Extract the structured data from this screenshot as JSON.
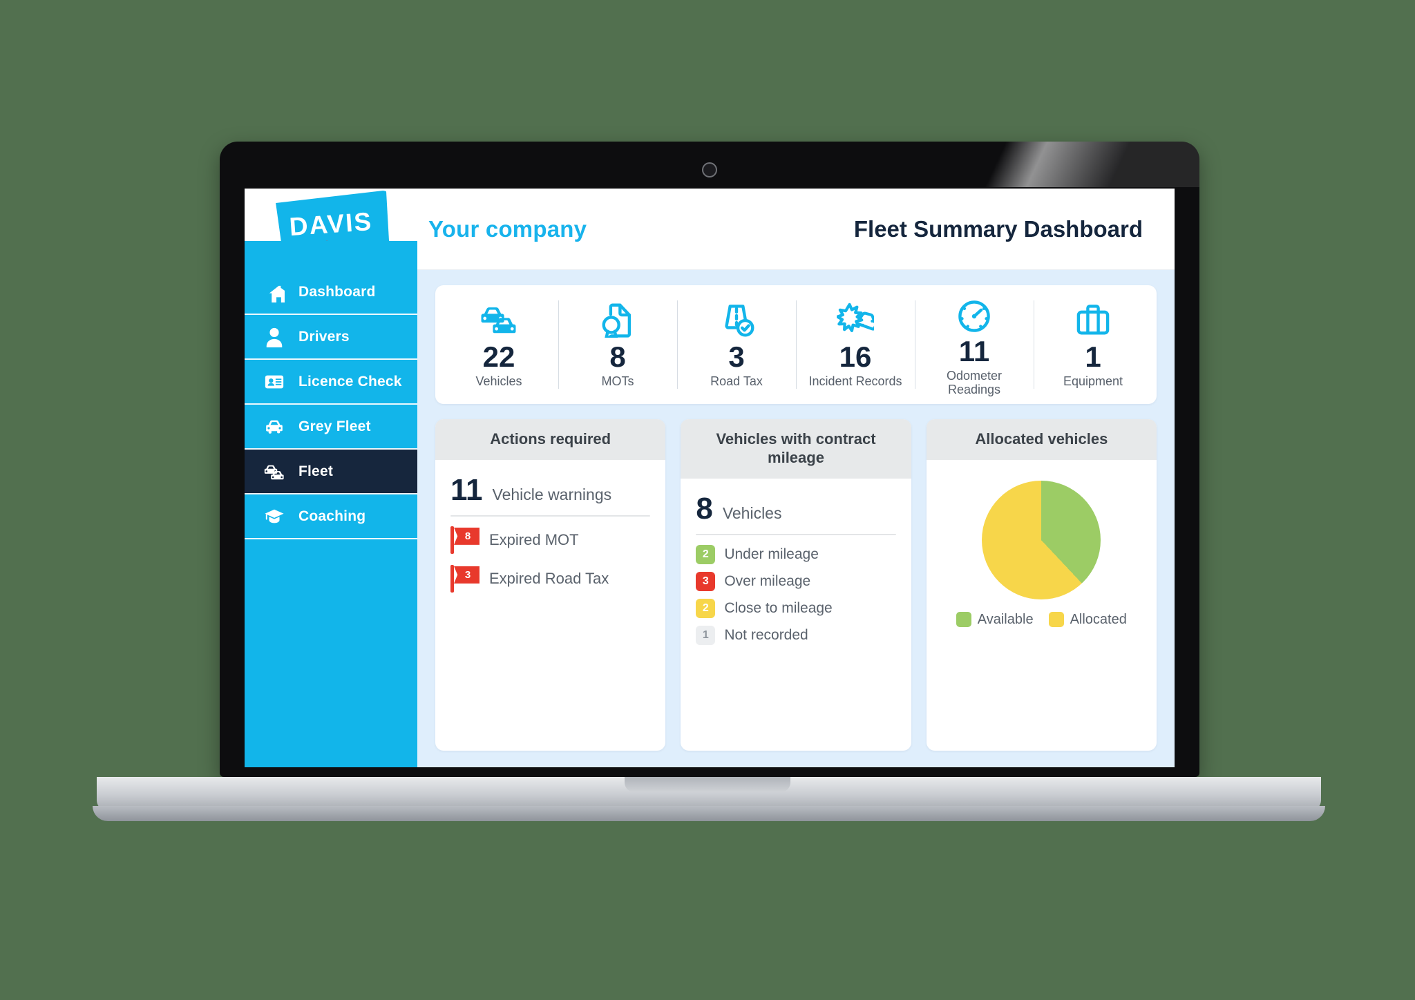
{
  "brand": {
    "logo_text": "DAVIS",
    "logo_dots": [
      "#8cc152",
      "#f7d64a",
      "#e8392c"
    ],
    "primary": "#12b5ea",
    "dark": "#16263d"
  },
  "header": {
    "company": "Your company",
    "page_title": "Fleet Summary Dashboard"
  },
  "sidebar": {
    "items": [
      {
        "label": "Dashboard",
        "icon": "home-icon",
        "active": false
      },
      {
        "label": "Drivers",
        "icon": "user-icon",
        "active": false
      },
      {
        "label": "Licence Check",
        "icon": "id-card-icon",
        "active": false
      },
      {
        "label": "Grey Fleet",
        "icon": "car-icon",
        "active": false
      },
      {
        "label": "Fleet",
        "icon": "two-cars-icon",
        "active": true
      },
      {
        "label": "Coaching",
        "icon": "graduation-cap-icon",
        "active": false
      }
    ]
  },
  "kpis": [
    {
      "value": "22",
      "label": "Vehicles",
      "icon": "two-cars-icon"
    },
    {
      "value": "8",
      "label": "MOTs",
      "icon": "certificate-icon"
    },
    {
      "value": "3",
      "label": "Road Tax",
      "icon": "road-check-icon"
    },
    {
      "value": "16",
      "label": "Incident\nRecords",
      "icon": "collision-icon"
    },
    {
      "value": "11",
      "label": "Odometer\nReadings",
      "icon": "speedometer-icon"
    },
    {
      "value": "1",
      "label": "Equipment",
      "icon": "briefcase-icon"
    }
  ],
  "cards": {
    "actions": {
      "title": "Actions required",
      "summary_value": "11",
      "summary_label": "Vehicle warnings",
      "items": [
        {
          "count": "8",
          "label": "Expired MOT",
          "color": "#e8392c"
        },
        {
          "count": "3",
          "label": "Expired Road Tax",
          "color": "#e8392c"
        }
      ]
    },
    "mileage": {
      "title": "Vehicles with\ncontract mileage",
      "summary_value": "8",
      "summary_label": "Vehicles",
      "items": [
        {
          "count": "2",
          "label": "Under mileage",
          "bg": "#9ccc65",
          "fg": "#ffffff"
        },
        {
          "count": "3",
          "label": "Over mileage",
          "bg": "#e8392c",
          "fg": "#ffffff"
        },
        {
          "count": "2",
          "label": "Close to mileage",
          "bg": "#f7d64a",
          "fg": "#ffffff"
        },
        {
          "count": "1",
          "label": "Not recorded",
          "bg": "#eceef0",
          "fg": "#8e959d"
        }
      ]
    },
    "allocated": {
      "title": "Allocated vehicles",
      "chart_data": {
        "type": "pie",
        "title": "Allocated vehicles",
        "labels": [
          "Available",
          "Allocated"
        ],
        "values": [
          38,
          62
        ],
        "colors": [
          "#9ccc65",
          "#f7d64a"
        ],
        "legend_position": "bottom",
        "units": "percent"
      }
    }
  }
}
